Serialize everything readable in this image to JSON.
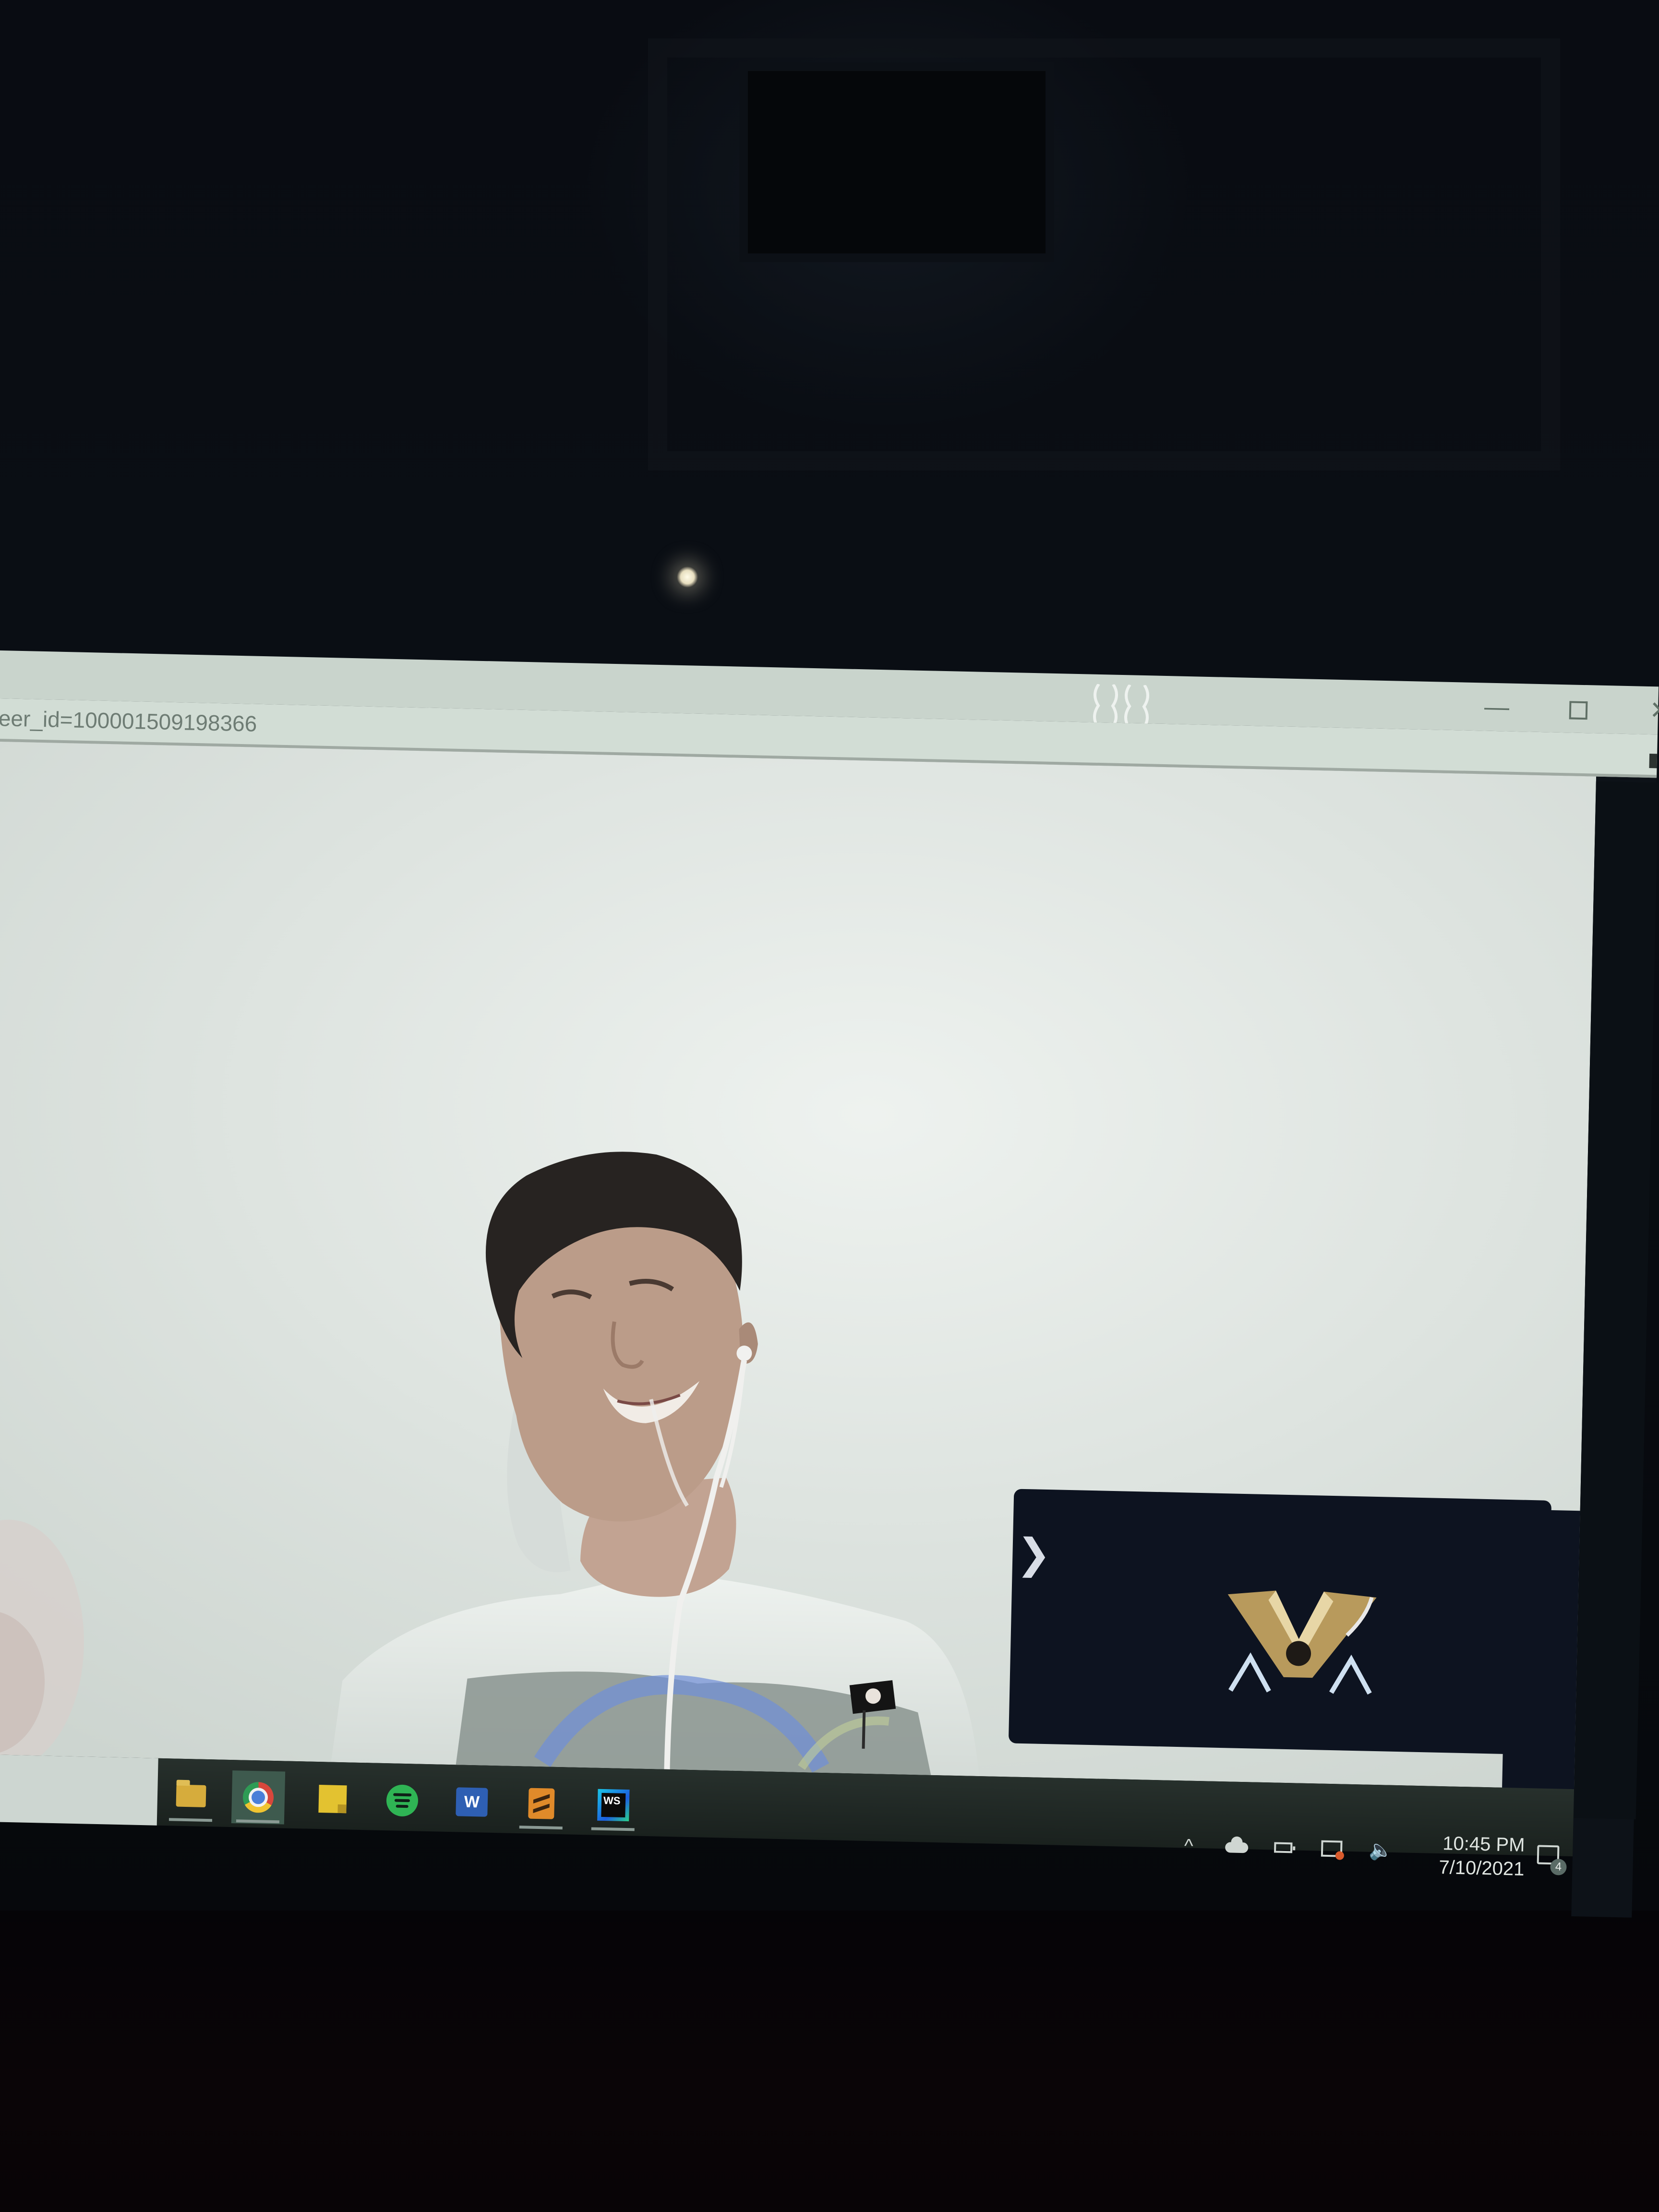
{
  "window": {
    "url_text": "eer_id=100001509198366",
    "minimize_glyph": "—",
    "close_glyph": "✕"
  },
  "call": {
    "self_view_toggle_glyph": "❯",
    "self_view_avatar_icon": "gold-v-emblem-icon"
  },
  "taskbar": {
    "pinned_apps": [
      {
        "name": "File Explorer",
        "icon": "folder-icon"
      },
      {
        "name": "Google Chrome",
        "icon": "chrome-icon"
      },
      {
        "name": "Sticky Notes",
        "icon": "sticky-notes-icon"
      },
      {
        "name": "Spotify",
        "icon": "spotify-icon"
      },
      {
        "name": "Microsoft Word",
        "icon": "word-icon",
        "label": "W"
      },
      {
        "name": "Sublime Text",
        "icon": "sublime-icon"
      },
      {
        "name": "WebStorm",
        "icon": "webstorm-icon",
        "label": "WS"
      }
    ],
    "tray": {
      "chevron_glyph": "^",
      "volume_glyph": "🔈",
      "time": "10:45 PM",
      "date": "7/10/2021",
      "notification_count": "4"
    }
  },
  "colors": {
    "room_dark": "#06080c",
    "call_background": "#dfe6e2",
    "self_view_panel": "#0d1320",
    "taskbar": "#1f2724",
    "shirt": "#e6ebe8",
    "skin": "#b99a88"
  }
}
